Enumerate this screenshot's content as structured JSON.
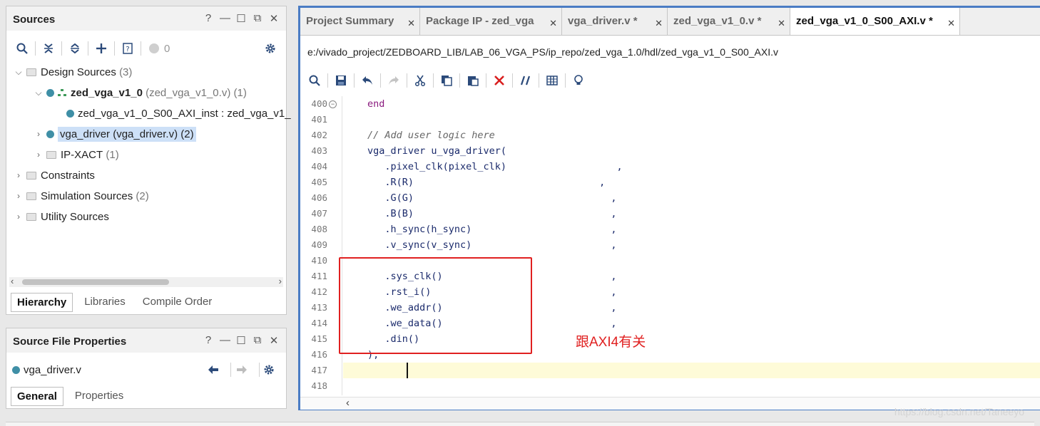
{
  "sources_panel": {
    "title": "Sources",
    "win_controls": [
      "?",
      "—",
      "☐",
      "⧉",
      "✕"
    ],
    "toolbar_count": "0",
    "tree": [
      {
        "label": "Design Sources",
        "extra": "(3)"
      },
      {
        "label": "zed_vga_v1_0",
        "extra": "(zed_vga_v1_0.v) (1)"
      },
      {
        "label": "zed_vga_v1_0_S00_AXI_inst : zed_vga_v1_",
        "extra": ""
      },
      {
        "label": "vga_driver (vga_driver.v) (2)",
        "extra": ""
      },
      {
        "label": "IP-XACT",
        "extra": "(1)"
      },
      {
        "label": "Constraints",
        "extra": ""
      },
      {
        "label": "Simulation Sources",
        "extra": "(2)"
      },
      {
        "label": "Utility Sources",
        "extra": ""
      }
    ],
    "tabs": [
      "Hierarchy",
      "Libraries",
      "Compile Order"
    ]
  },
  "properties_panel": {
    "title": "Source File Properties",
    "file": "vga_driver.v",
    "tabs": [
      "General",
      "Properties"
    ]
  },
  "editor": {
    "tabs": [
      {
        "label": "Project Summary"
      },
      {
        "label": "Package IP - zed_vga"
      },
      {
        "label": "vga_driver.v *"
      },
      {
        "label": "zed_vga_v1_0.v *"
      },
      {
        "label": "zed_vga_v1_0_S00_AXI.v *"
      }
    ],
    "path": "e:/vivado_project/ZEDBOARD_LIB/LAB_06_VGA_PS/ip_repo/zed_vga_1.0/hdl/zed_vga_v1_0_S00_AXI.v",
    "lines": [
      {
        "n": "400",
        "code": "end"
      },
      {
        "n": "401",
        "code": ""
      },
      {
        "n": "402",
        "code": "// Add user logic here"
      },
      {
        "n": "403",
        "code": "vga_driver u_vga_driver("
      },
      {
        "n": "404",
        "code": "   .pixel_clk(pixel_clk)                   ,"
      },
      {
        "n": "405",
        "code": "   .R(R)                                ,"
      },
      {
        "n": "406",
        "code": "   .G(G)                                  ,"
      },
      {
        "n": "407",
        "code": "   .B(B)                                  ,"
      },
      {
        "n": "408",
        "code": "   .h_sync(h_sync)                        ,"
      },
      {
        "n": "409",
        "code": "   .v_sync(v_sync)                        ,"
      },
      {
        "n": "410",
        "code": ""
      },
      {
        "n": "411",
        "code": "   .sys_clk()                             ,"
      },
      {
        "n": "412",
        "code": "   .rst_i()                               ,"
      },
      {
        "n": "413",
        "code": "   .we_addr()                             ,"
      },
      {
        "n": "414",
        "code": "   .we_data()                             ,"
      },
      {
        "n": "415",
        "code": "   .din()"
      },
      {
        "n": "416",
        "code": ");"
      },
      {
        "n": "417",
        "code": ""
      },
      {
        "n": "418",
        "code": ""
      }
    ],
    "annotation": "跟AXI4有关"
  },
  "watermark": "https://blog.csdn.net/Taneeyo",
  "colors": {
    "accent_blue": "#4a7cc4",
    "annotation_red": "#e02020",
    "highlight": "#fefbd8"
  }
}
